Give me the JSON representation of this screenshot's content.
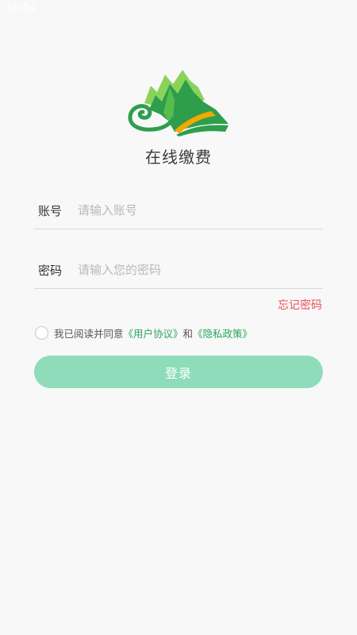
{
  "status_bar": {
    "time": "10:54"
  },
  "app": {
    "title": "在线缴费",
    "logo_icon": "mountain-book-logo",
    "colors": {
      "logo_green": "#2e9e4c",
      "logo_light_green": "#8ad35a",
      "logo_orange": "#f2a900"
    }
  },
  "login_form": {
    "account": {
      "label": "账号",
      "placeholder": "请输入账号",
      "value": ""
    },
    "password": {
      "label": "密码",
      "placeholder": "请输入您的密码",
      "value": ""
    },
    "forgot_password": "忘记密码",
    "agreement": {
      "checked": false,
      "prefix": "我已阅读并同意",
      "user_agreement": "《用户协议》",
      "conjunction": "和",
      "privacy_policy": "《隐私政策》"
    },
    "submit_label": "登录"
  },
  "colors": {
    "background": "#f8f8f8",
    "button": "#8fdcba",
    "link_green": "#2aa55c",
    "forgot_red": "#e8505b"
  }
}
